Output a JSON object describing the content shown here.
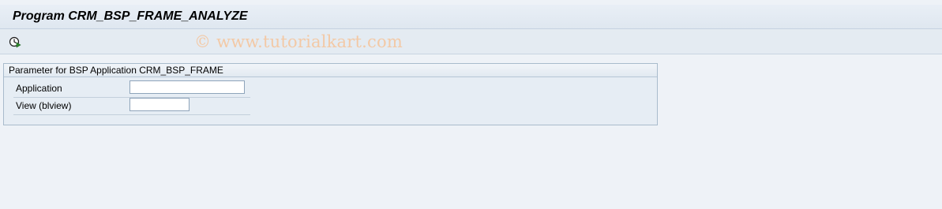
{
  "window": {
    "title": "Program CRM_BSP_FRAME_ANALYZE"
  },
  "toolbar": {
    "execute_icon": "execute-clock-icon",
    "watermark": "© www.tutorialkart.com"
  },
  "parameters": {
    "group_title": "Parameter for BSP Application CRM_BSP_FRAME",
    "fields": [
      {
        "label": "Application",
        "value": ""
      },
      {
        "label": "View (blview)",
        "value": ""
      }
    ]
  },
  "colors": {
    "background": "#eef2f7",
    "title_bar": "#e4ebf2",
    "group_border": "#a9bbcc",
    "watermark": "#f3c9a6"
  }
}
